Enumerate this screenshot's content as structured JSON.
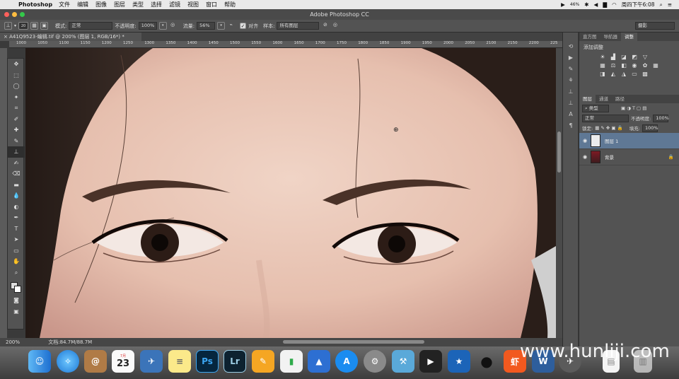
{
  "menubar": {
    "app_name": "Photoshop",
    "items": [
      "文件",
      "编辑",
      "图像",
      "图层",
      "类型",
      "选择",
      "滤镜",
      "视图",
      "窗口",
      "帮助"
    ],
    "battery": "46%",
    "clock": "周四下午6:08"
  },
  "window": {
    "title": "Adobe Photoshop CC"
  },
  "options": {
    "brush_size": "20",
    "mode_label": "模式:",
    "mode_value": "正常",
    "opacity_label": "不透明度:",
    "opacity_value": "100%",
    "flow_label": "流量:",
    "flow_value": "56%",
    "align_label": "对齐",
    "sample_label": "样本:",
    "sample_value": "所有图层",
    "workspace": "摄影"
  },
  "document": {
    "tab_title": "A41Q9523-编辑.tif @ 200% (图层 1, RGB/16*) *",
    "zoom": "200%",
    "doc_size": "文档:84.7M/88.7M"
  },
  "ruler": {
    "ticks": [
      "1000",
      "1050",
      "1100",
      "1150",
      "1200",
      "1250",
      "1300",
      "1350",
      "1400",
      "1450",
      "1500",
      "1550",
      "1600",
      "1650",
      "1700",
      "1750",
      "1800",
      "1850",
      "1900",
      "1950",
      "2000",
      "2050",
      "2100",
      "2150",
      "2200",
      "225"
    ]
  },
  "adjustments_panel": {
    "tabs": [
      "直方图",
      "导航器",
      "调整"
    ],
    "title": "添加调整"
  },
  "layers_panel": {
    "tabs": [
      "图层",
      "通道",
      "路径"
    ],
    "filter_label": "类型",
    "blend_mode": "正常",
    "opacity_label": "不透明度:",
    "opacity_value": "100%",
    "lock_label": "锁定:",
    "fill_label": "填充:",
    "fill_value": "100%",
    "layers": [
      {
        "name": "图层 1",
        "selected": true
      },
      {
        "name": "背景",
        "selected": false
      }
    ]
  },
  "tools": [
    "move-tool",
    "marquee-tool",
    "lasso-tool",
    "quick-select-tool",
    "crop-tool",
    "eyedropper-tool",
    "healing-brush-tool",
    "brush-tool",
    "clone-stamp-tool",
    "history-brush-tool",
    "eraser-tool",
    "gradient-tool",
    "blur-tool",
    "dodge-tool",
    "pen-tool",
    "type-tool",
    "path-select-tool",
    "shape-tool",
    "hand-tool",
    "zoom-tool"
  ],
  "dock": {
    "calendar_month": "7月",
    "calendar_day": "23",
    "apps": [
      "finder",
      "safari",
      "contacts",
      "calendar",
      "preview",
      "notes",
      "photoshop",
      "lightroom",
      "pages",
      "numbers",
      "keynote",
      "app-store",
      "system-preferences",
      "xcode",
      "final-cut",
      "imovie",
      "qq",
      "xiami",
      "wunderlist",
      "mission-control",
      "document",
      "trash"
    ],
    "ps_label": "Ps",
    "lr_label": "Lr",
    "xia_label": "虾"
  },
  "watermark": {
    "text": "www.hunliji.com"
  }
}
